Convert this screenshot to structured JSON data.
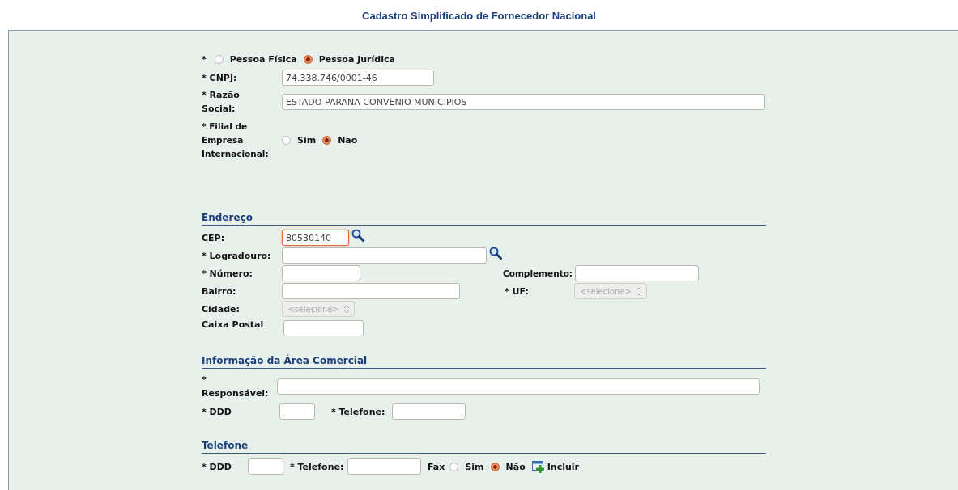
{
  "title": "Cadastro Simplificado de Fornecedor Nacional",
  "person_type": {
    "mark": "*",
    "options": [
      {
        "label": "Pessoa Física",
        "selected": false
      },
      {
        "label": "Pessoa Jurídica",
        "selected": true
      }
    ]
  },
  "cnpj": {
    "label": "* CNPJ:",
    "value": "74.338.746/0001-46"
  },
  "razao_social": {
    "label": "* Razão Social:",
    "value": "ESTADO PARANA CONVENIO MUNICIPIOS"
  },
  "filial": {
    "label": "* Filial de Empresa Internacional:",
    "options": [
      {
        "label": "Sim",
        "selected": false
      },
      {
        "label": "Não",
        "selected": true
      }
    ]
  },
  "address": {
    "heading": "Endereço",
    "cep": {
      "label": "CEP:",
      "value": "80530140",
      "focused": true
    },
    "logradouro": {
      "label": "* Logradouro:"
    },
    "numero": {
      "label": "* Número:"
    },
    "complemento": {
      "label": "Complemento:"
    },
    "bairro": {
      "label": "Bairro:"
    },
    "uf": {
      "label": "* UF:",
      "placeholder": "<selecione>",
      "disabled": true
    },
    "cidade": {
      "label": "Cidade:",
      "placeholder": "<selecione>",
      "disabled": true
    },
    "caixa_postal": {
      "label": "Caixa Postal"
    }
  },
  "commercial": {
    "heading": "Informação da Área Comercial",
    "responsavel": {
      "label": "* Responsável:"
    },
    "ddd": {
      "label": "* DDD"
    },
    "telefone": {
      "label": "* Telefone:"
    }
  },
  "phone": {
    "heading": "Telefone",
    "ddd": {
      "label": "* DDD"
    },
    "telefone": {
      "label": "* Telefone:"
    },
    "fax": {
      "label": "Fax",
      "options": [
        {
          "label": "Sim",
          "selected": false
        },
        {
          "label": "Não",
          "selected": true
        }
      ]
    },
    "add_link": "Incluir"
  }
}
